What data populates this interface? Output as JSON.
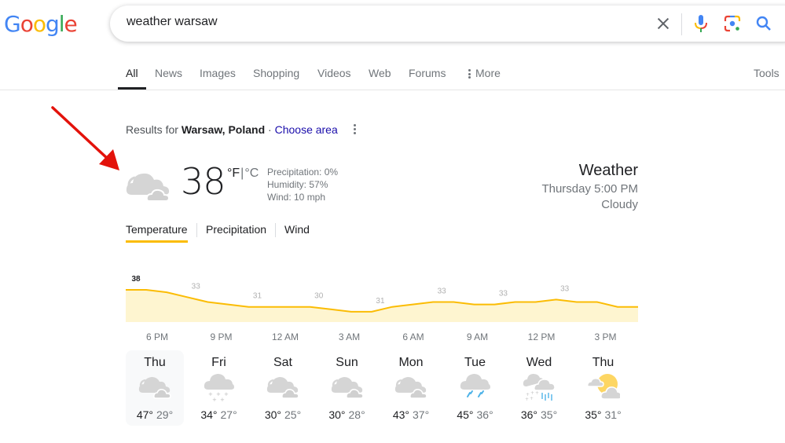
{
  "logo": {
    "letters": [
      {
        "ch": "G",
        "color": "#4285f4"
      },
      {
        "ch": "o",
        "color": "#ea4335"
      },
      {
        "ch": "o",
        "color": "#fbbc05"
      },
      {
        "ch": "g",
        "color": "#4285f4"
      },
      {
        "ch": "l",
        "color": "#34a853"
      },
      {
        "ch": "e",
        "color": "#ea4335"
      }
    ]
  },
  "search": {
    "query": "weather warsaw",
    "icons": [
      "close-icon",
      "microphone-icon",
      "google-lens-icon",
      "search-icon"
    ]
  },
  "nav": {
    "tabs": [
      {
        "label": "All",
        "active": true
      },
      {
        "label": "News"
      },
      {
        "label": "Images"
      },
      {
        "label": "Shopping"
      },
      {
        "label": "Videos"
      },
      {
        "label": "Web"
      },
      {
        "label": "Forums"
      },
      {
        "label": "More",
        "icon": "kebab-icon"
      }
    ],
    "tools": "Tools"
  },
  "results_for": {
    "prefix": "Results for ",
    "location": "Warsaw, Poland",
    "separator": " · ",
    "choose_area": "Choose area"
  },
  "current": {
    "icon": "cloudy-icon",
    "temp": "38",
    "unit_f": "°F",
    "unit_sep": "|",
    "unit_c": "°C",
    "precipitation": "Precipitation: 0%",
    "humidity": "Humidity: 57%",
    "wind": "Wind: 10 mph",
    "title": "Weather",
    "time": "Thursday 5:00 PM",
    "condition": "Cloudy"
  },
  "subtabs": [
    {
      "label": "Temperature",
      "active": true
    },
    {
      "label": "Precipitation"
    },
    {
      "label": "Wind"
    }
  ],
  "chart_data": {
    "type": "area",
    "title": "Temperature",
    "unit": "°F",
    "x_tick_labels": [
      "6 PM",
      "9 PM",
      "12 AM",
      "3 AM",
      "6 AM",
      "9 AM",
      "12 PM",
      "3 PM"
    ],
    "labeled_points": [
      {
        "index": 0,
        "label": "38"
      },
      {
        "index": 3,
        "label": "33"
      },
      {
        "index": 6,
        "label": "31"
      },
      {
        "index": 9,
        "label": "30"
      },
      {
        "index": 12,
        "label": "31"
      },
      {
        "index": 15,
        "label": "33"
      },
      {
        "index": 18,
        "label": "33"
      },
      {
        "index": 21,
        "label": "33"
      }
    ],
    "hourly_values": [
      38,
      38,
      37,
      35,
      33,
      32,
      31,
      31,
      31,
      31,
      30,
      29,
      29,
      31,
      32,
      33,
      33,
      32,
      32,
      33,
      33,
      34,
      33,
      33,
      31,
      31
    ],
    "ylim": [
      24,
      40
    ],
    "line_color": "#fbbc04",
    "fill_color": "#fef5d0"
  },
  "forecast": [
    {
      "day": "Thu",
      "icon": "cloudy-icon",
      "hi": "47°",
      "lo": "29°",
      "selected": true
    },
    {
      "day": "Fri",
      "icon": "snow-icon",
      "hi": "34°",
      "lo": "27°"
    },
    {
      "day": "Sat",
      "icon": "cloudy-icon",
      "hi": "30°",
      "lo": "25°"
    },
    {
      "day": "Sun",
      "icon": "cloudy-icon",
      "hi": "30°",
      "lo": "28°"
    },
    {
      "day": "Mon",
      "icon": "cloudy-icon",
      "hi": "43°",
      "lo": "37°"
    },
    {
      "day": "Tue",
      "icon": "rain-icon",
      "hi": "45°",
      "lo": "36°"
    },
    {
      "day": "Wed",
      "icon": "rain-and-snow-icon",
      "hi": "36°",
      "lo": "35°"
    },
    {
      "day": "Thu",
      "icon": "partly-sunny-icon",
      "hi": "35°",
      "lo": "31°"
    }
  ]
}
